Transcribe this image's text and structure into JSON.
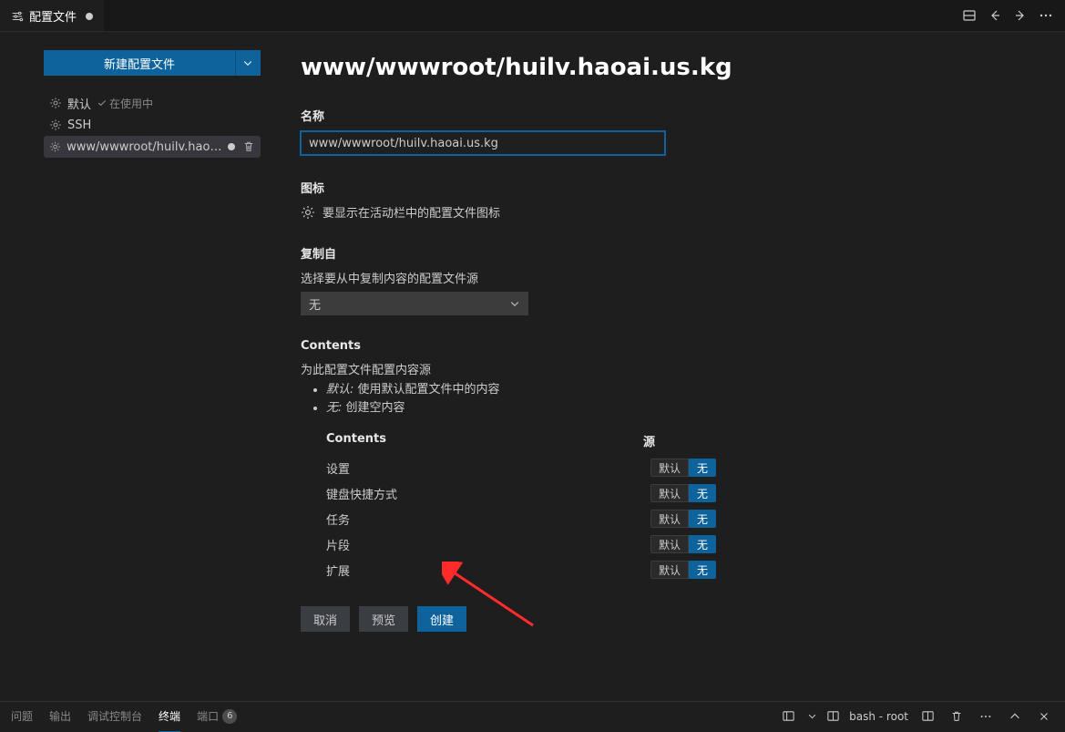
{
  "tab": {
    "title": "配置文件"
  },
  "sidebar": {
    "newButton": "新建配置文件",
    "items": [
      {
        "label": "默认",
        "inUse": "在使用中"
      },
      {
        "label": "SSH"
      },
      {
        "label": "www/wwwroot/huilv.haoai…"
      }
    ]
  },
  "page": {
    "title": "www/wwwroot/huilv.haoai.us.kg",
    "name": {
      "label": "名称",
      "value": "www/wwwroot/huilv.haoai.us.kg"
    },
    "icon": {
      "label": "图标",
      "desc": "要显示在活动栏中的配置文件图标"
    },
    "copy": {
      "label": "复制自",
      "desc": "选择要从中复制内容的配置文件源",
      "value": "无"
    },
    "contents": {
      "label": "Contents",
      "desc": "为此配置文件配置内容源",
      "bullet1a": "默认:",
      "bullet1b": "使用默认配置文件中的内容",
      "bullet2a": "无:",
      "bullet2b": "创建空内容",
      "headContents": "Contents",
      "headSource": "源",
      "rows": [
        {
          "name": "设置"
        },
        {
          "name": "键盘快捷方式"
        },
        {
          "name": "任务"
        },
        {
          "name": "片段"
        },
        {
          "name": "扩展"
        }
      ],
      "pillDefault": "默认",
      "pillNone": "无"
    },
    "actions": {
      "cancel": "取消",
      "preview": "预览",
      "create": "创建"
    }
  },
  "panel": {
    "tabs": {
      "problems": "问题",
      "output": "输出",
      "debug": "调试控制台",
      "terminal": "终端",
      "ports": "端口",
      "portsBadge": "6"
    },
    "terminal": "bash - root"
  }
}
